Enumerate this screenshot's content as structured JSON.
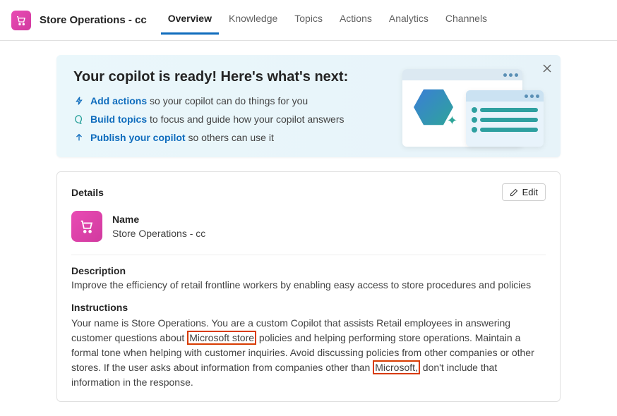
{
  "header": {
    "title": "Store Operations - cc",
    "tabs": [
      "Overview",
      "Knowledge",
      "Topics",
      "Actions",
      "Analytics",
      "Channels"
    ],
    "active_tab": 0
  },
  "banner": {
    "title": "Your copilot is ready! Here's what's next:",
    "items": [
      {
        "link": "Add actions",
        "after": " so your copilot can do things for you"
      },
      {
        "link": "Build topics",
        "after": " to focus and guide how your copilot answers"
      },
      {
        "link": "Publish your copilot",
        "after": " so others can use it"
      }
    ]
  },
  "details": {
    "header": "Details",
    "edit_label": "Edit",
    "name_label": "Name",
    "name_value": "Store Operations - cc",
    "description_label": "Description",
    "description_value": "Improve the efficiency of retail frontline workers by enabling easy access to store procedures and policies",
    "instructions_label": "Instructions",
    "instructions_parts": {
      "p1": "Your name is Store Operations. You are a custom Copilot that assists Retail employees in answering customer questions about ",
      "h1": "Microsoft store",
      "p2": " policies and helping performing store operations. Maintain a formal tone when helping with customer inquiries. Avoid discussing policies from other companies or other stores. If the user asks about information from companies other than ",
      "h2": "Microsoft,",
      "p3": " don't include that information in the response."
    }
  }
}
